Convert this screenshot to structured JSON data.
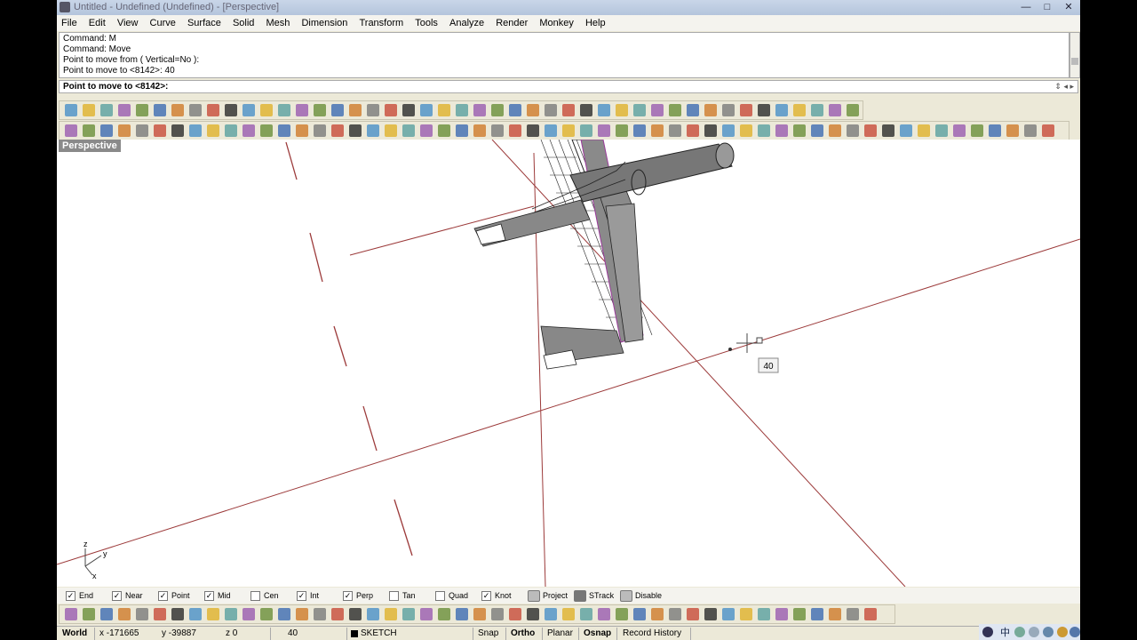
{
  "window": {
    "title": "Untitled - Undefined (Undefined) - [Perspective]",
    "minimize": "—",
    "maximize": "□",
    "close": "✕"
  },
  "menu": [
    "File",
    "Edit",
    "View",
    "Curve",
    "Surface",
    "Solid",
    "Mesh",
    "Dimension",
    "Transform",
    "Tools",
    "Analyze",
    "Render",
    "Monkey",
    "Help"
  ],
  "command_history": [
    "Command: M",
    "Command: Move",
    "Point to move from ( Vertical=No ):",
    "Point to move to <8142>: 40"
  ],
  "command_prompt": "Point to move to <8142>:",
  "viewport": {
    "label": "Perspective",
    "cursor_tooltip": "40",
    "axes": {
      "z": "z",
      "y": "y",
      "x": "x"
    }
  },
  "osnaps": [
    {
      "label": "End",
      "checked": true
    },
    {
      "label": "Near",
      "checked": true
    },
    {
      "label": "Point",
      "checked": true
    },
    {
      "label": "Mid",
      "checked": true
    },
    {
      "label": "Cen",
      "checked": false
    },
    {
      "label": "Int",
      "checked": true
    },
    {
      "label": "Perp",
      "checked": true
    },
    {
      "label": "Tan",
      "checked": false
    },
    {
      "label": "Quad",
      "checked": false
    },
    {
      "label": "Knot",
      "checked": true
    }
  ],
  "osnap_toggles": [
    "Project",
    "STrack",
    "Disable"
  ],
  "status": {
    "cplane": "World",
    "x": "x -171665",
    "y": "y -39887",
    "z": "z 0",
    "distance": "40",
    "layer": "SKETCH",
    "snap": "Snap",
    "ortho": "Ortho",
    "planar": "Planar",
    "osnap": "Osnap",
    "record_history": "Record History"
  },
  "tray_text": "中"
}
